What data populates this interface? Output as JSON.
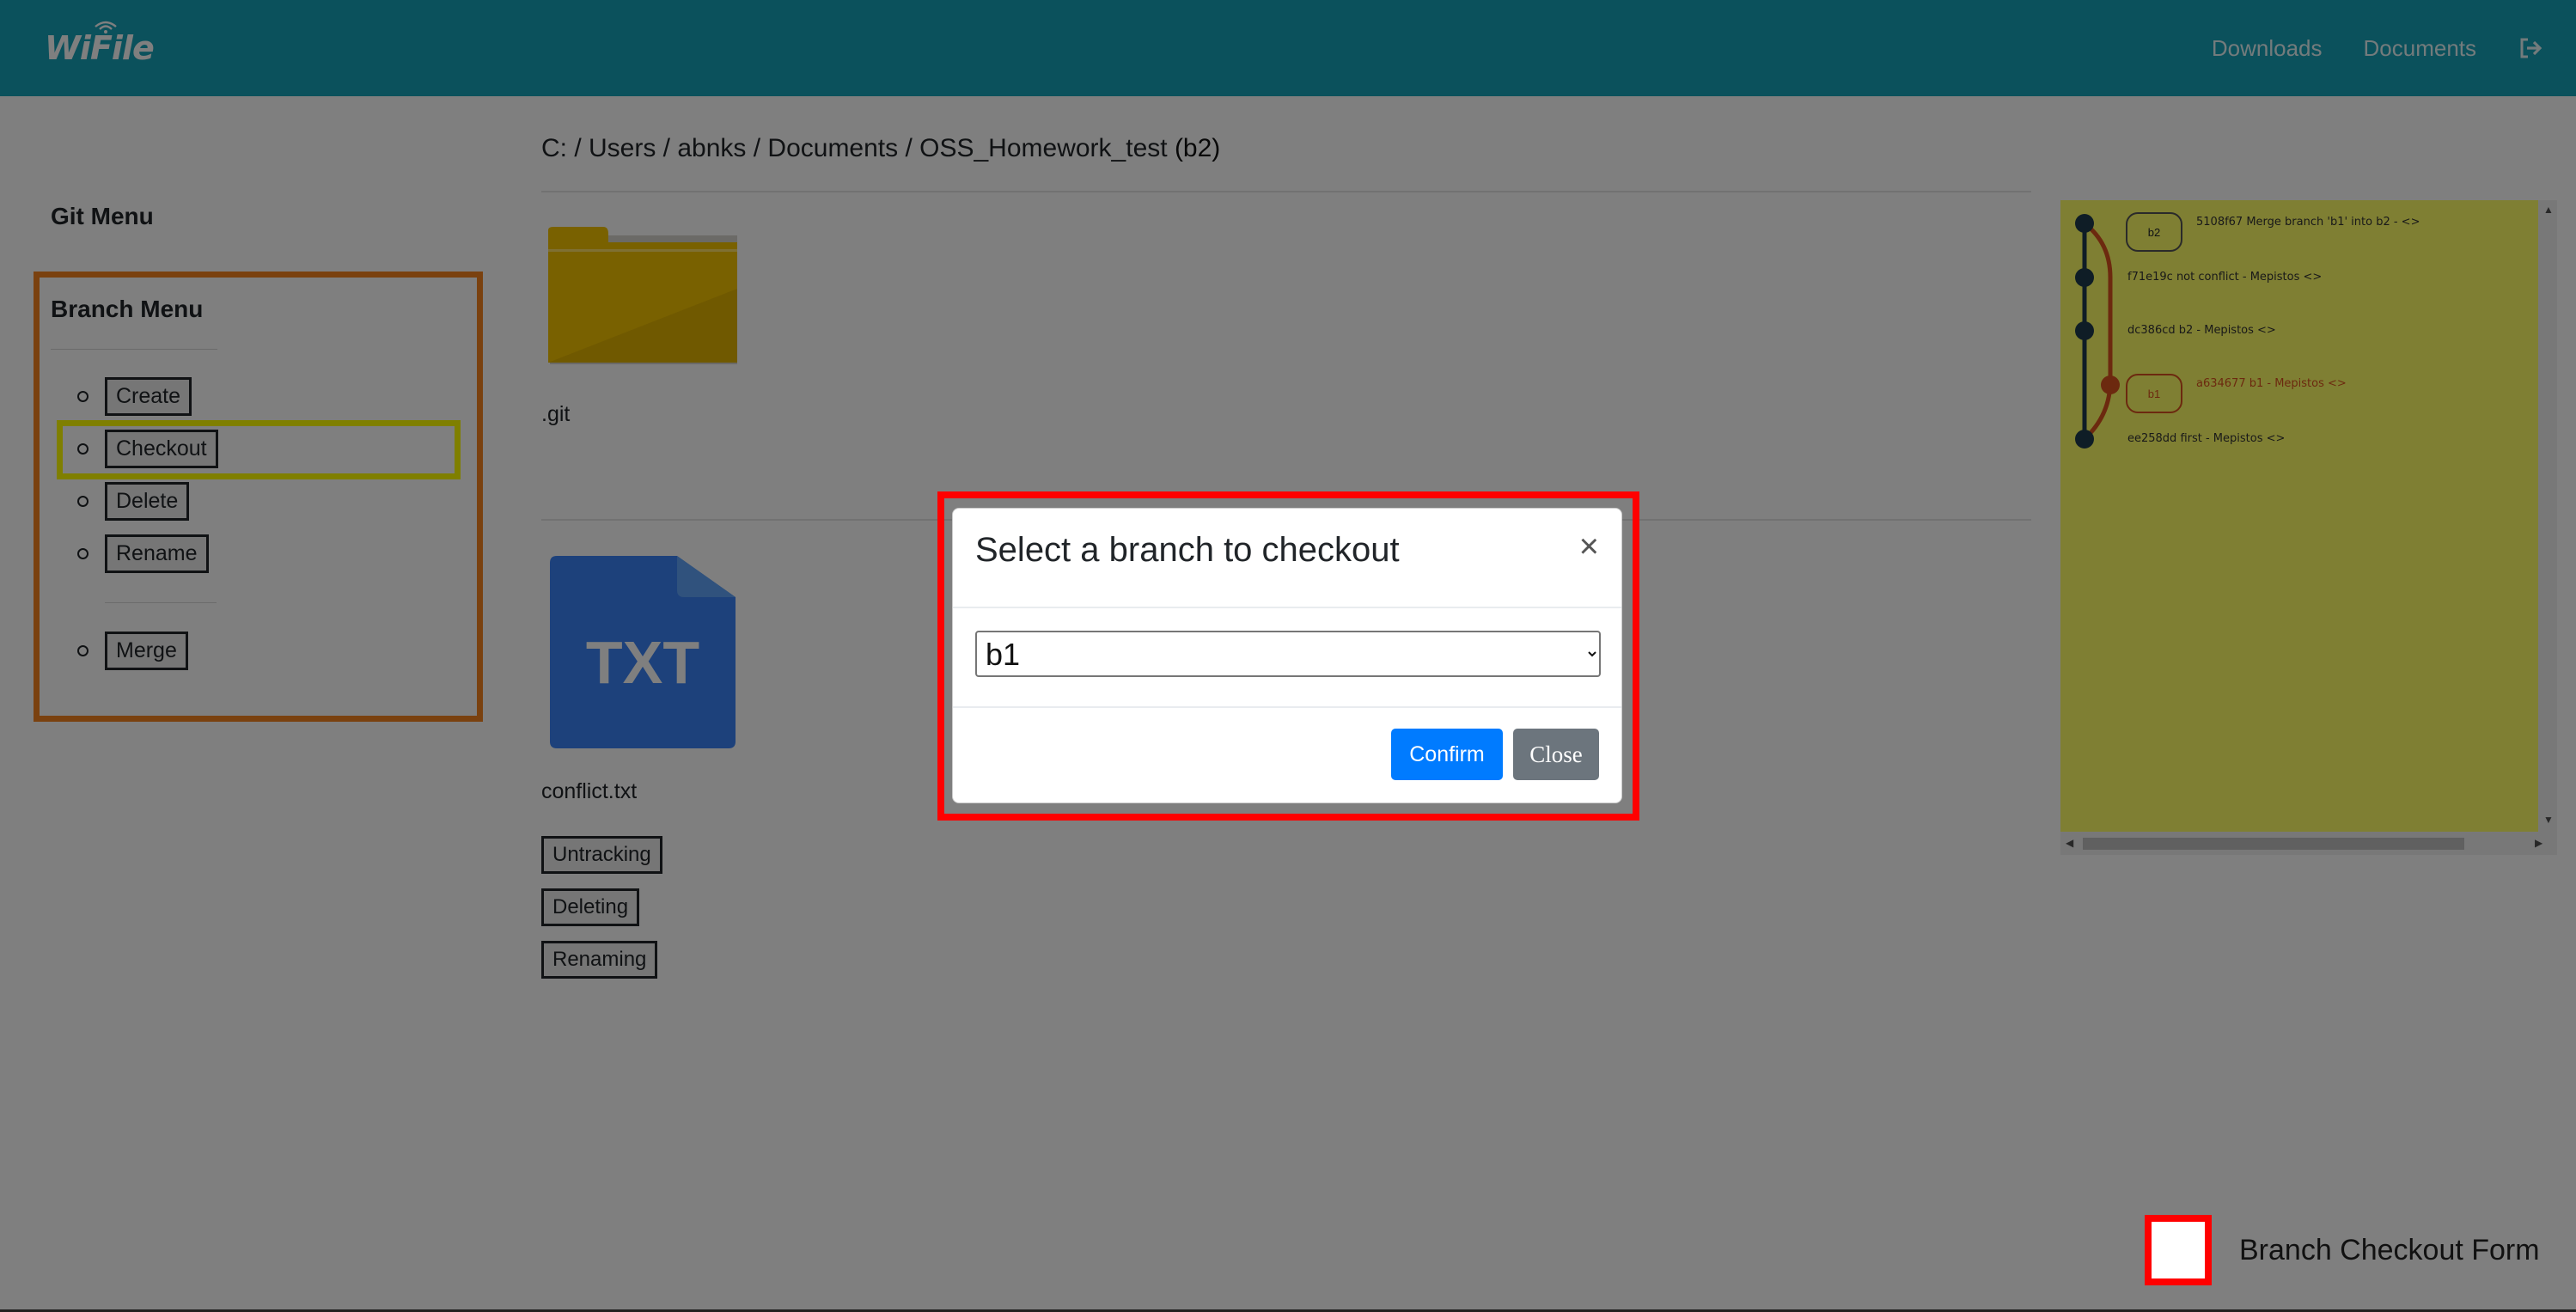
{
  "navbar": {
    "brand": "WiFile",
    "links": [
      "Downloads",
      "Documents"
    ],
    "logout_icon": "sign-out-icon",
    "color": "#17a2b8"
  },
  "sidebar": {
    "git_menu_title": "Git Menu",
    "branch_menu_title": "Branch Menu",
    "items": [
      "Create",
      "Checkout",
      "Delete",
      "Rename",
      "Merge"
    ]
  },
  "breadcrumb": {
    "path": "C: / Users / abnks / Documents / OSS_Homework_test",
    "branch": "(b2)"
  },
  "files": {
    "folder_name": ".git",
    "txt_badge": "TXT",
    "file_name": "conflict.txt",
    "actions": [
      "Untracking",
      "Deleting",
      "Renaming"
    ]
  },
  "git_graph": {
    "commits": [
      {
        "text": "5108f67 Merge branch 'b1' into b2 - <>",
        "tag": "b2"
      },
      {
        "text": "f71e19c not conflict - Mepistos <>",
        "tag": ""
      },
      {
        "text": "dc386cd b2 - Mepistos <>",
        "tag": ""
      },
      {
        "text": "a634677 b1 - Mepistos <>",
        "tag": "b1"
      },
      {
        "text": "ee258dd first - Mepistos <>",
        "tag": ""
      }
    ],
    "main_color": "#1e3a4c",
    "branch_color": "#d9531e",
    "background": "#ffff66"
  },
  "modal": {
    "title": "Select a branch to checkout",
    "close_glyph": "×",
    "selected_branch": "b1",
    "confirm_label": "Confirm",
    "close_label": "Close"
  },
  "legend": {
    "label": "Branch Checkout Form",
    "color": "#ff0000"
  }
}
